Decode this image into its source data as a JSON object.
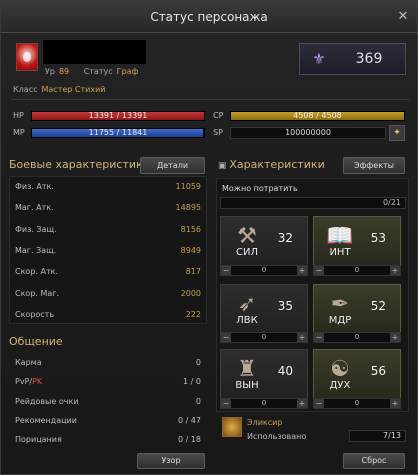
{
  "window": {
    "title": "Статус персонажа",
    "close": "✕"
  },
  "character": {
    "level_label": "Ур",
    "level": "89",
    "status_label": "Статус",
    "status": "Граф",
    "class_label": "Класс",
    "class": "Мастер Стихий"
  },
  "rank": {
    "icon": "rank-emblem-icon",
    "value": "369"
  },
  "bars": {
    "hp": {
      "label": "HP",
      "text": "13391 / 13391",
      "fill": 1.0
    },
    "mp": {
      "label": "MP",
      "text": "11755 / 11841",
      "fill": 0.993
    },
    "cp": {
      "label": "CP",
      "text": "4508 / 4508",
      "fill": 1.0
    },
    "sp": {
      "label": "SP",
      "text": "100000000"
    }
  },
  "combat": {
    "title": "Боевые характеристики",
    "details_label": "Детали",
    "stats": [
      {
        "label": "Физ. Атк.",
        "value": "11059"
      },
      {
        "label": "Маг. Атк.",
        "value": "14895"
      },
      {
        "label": "Физ. Защ.",
        "value": "8156"
      },
      {
        "label": "Маг. Защ.",
        "value": "8949"
      },
      {
        "label": "Скор. Атк.",
        "value": "817"
      },
      {
        "label": "Скор. Маг.",
        "value": "2000"
      },
      {
        "label": "Скорость",
        "value": "222"
      }
    ]
  },
  "social": {
    "title": "Общение",
    "rows": [
      {
        "label": "Карма",
        "value": "0"
      },
      {
        "label_a": "PvP/",
        "label_b": "PK",
        "value": "1 / 0"
      },
      {
        "label": "Рейдовые очки",
        "value": "0"
      },
      {
        "label": "Рекомендации",
        "value": "0 / 47"
      },
      {
        "label": "Порицания",
        "value": "0 / 18"
      }
    ]
  },
  "characteristics": {
    "title": "Характеристики",
    "effects_label": "Эффекты",
    "spend_label": "Можно потратить",
    "spend_value": "0/21",
    "attrs": [
      {
        "abbr": "СИЛ",
        "value": "32",
        "step": "0",
        "icon": "strength-icon"
      },
      {
        "abbr": "ИНТ",
        "value": "53",
        "step": "0",
        "icon": "intelligence-icon"
      },
      {
        "abbr": "ЛВК",
        "value": "35",
        "step": "0",
        "icon": "dexterity-icon"
      },
      {
        "abbr": "МДР",
        "value": "52",
        "step": "0",
        "icon": "wisdom-icon"
      },
      {
        "abbr": "ВЫН",
        "value": "40",
        "step": "0",
        "icon": "constitution-icon"
      },
      {
        "abbr": "ДУХ",
        "value": "56",
        "step": "0",
        "icon": "spirit-icon"
      }
    ]
  },
  "elixir": {
    "title": "Эликсир",
    "used_label": "Использовано",
    "count": "7/13",
    "icon": "elixir-icon"
  },
  "footer": {
    "glyph_label": "Узор",
    "reset_label": "Сброс"
  }
}
